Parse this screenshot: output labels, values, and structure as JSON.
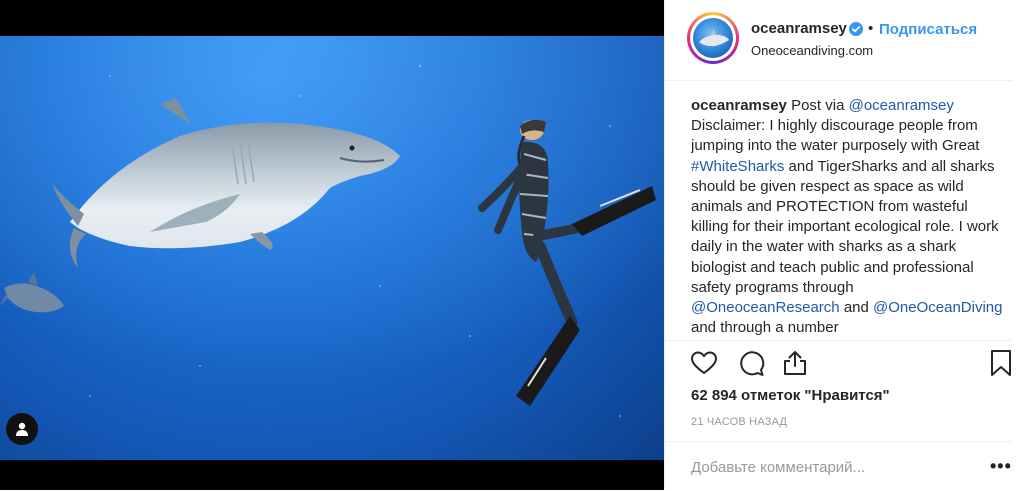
{
  "post": {
    "username": "oceanramsey",
    "follow_label": "Подписаться",
    "separator": "•",
    "location": "Oneoceandiving.com",
    "caption": {
      "username": "oceanramsey",
      "text_1": " Post via ",
      "mention_1": "@oceanramsey",
      "text_2": " Disclaimer: I highly discourage people from jumping into the water purposely with Great ",
      "hashtag_1": "#WhiteSharks",
      "text_3": " and TigerSharks and all sharks should be given respect as space as wild animals and PROTECTION from wasteful killing for their important ecological role. I work daily in the water with sharks as a shark biologist and teach public and professional safety programs through ",
      "mention_2": "@OneoceanResearch",
      "text_4": " and ",
      "mention_3": "@OneOceanDiving",
      "text_5": " and through a number"
    },
    "likes": "62 894 отметок \"Нравится\"",
    "timestamp": "21 ЧАСОВ НАЗАД",
    "comment_placeholder": "Добавьте комментарий...",
    "more_label": "•••"
  },
  "icons": {
    "like": "heart-icon",
    "comment": "comment-icon",
    "share": "share-icon",
    "save": "bookmark-icon",
    "verified": "verified-badge-icon",
    "tag": "user-tag-icon"
  },
  "colors": {
    "link": "#3897f0",
    "mention": "#1e4fa0",
    "ocean": "#1d72d8"
  }
}
